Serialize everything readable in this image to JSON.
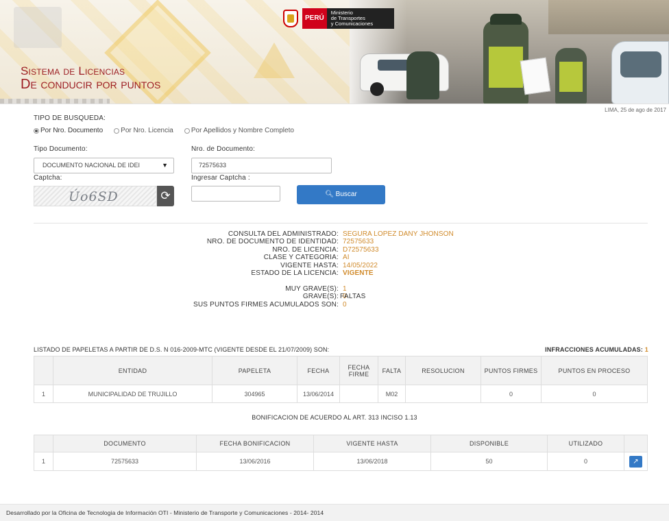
{
  "header": {
    "peru_label": "PERÚ",
    "ministry_line1": "Ministerio",
    "ministry_line2": "de Transportes",
    "ministry_line3": "y Comunicaciones",
    "title_line1": "Sistema de Licencias",
    "title_line2": "De conducir por puntos",
    "date": "LIMA, 25 de ago de 2017"
  },
  "search": {
    "tipo_busqueda_label": "TIPO DE BUSQUEDA:",
    "radio_options": [
      "Por Nro. Documento",
      "Por Nro. Licencia",
      "Por Apellidos y Nombre Completo"
    ],
    "selected_radio": 0,
    "tipo_documento_label": "Tipo Documento:",
    "tipo_documento_value": "DOCUMENTO NACIONAL DE IDEI",
    "nro_documento_label": "Nro. de Documento:",
    "nro_documento_value": "72575633",
    "captcha_label": "Captcha:",
    "captcha_text": "Úo6SD",
    "ingresar_captcha_label": "Ingresar Captcha :",
    "ingresar_captcha_value": "",
    "buscar_label": "Buscar"
  },
  "result": {
    "rows": [
      {
        "key": "CONSULTA DEL ADMINISTRADO:",
        "value": "SEGURA LOPEZ DANY JHONSON"
      },
      {
        "key": "NRO. DE DOCUMENTO DE IDENTIDAD:",
        "value": "72575633"
      },
      {
        "key": "NRO. DE LICENCIA:",
        "value": "D72575633"
      },
      {
        "key": "CLASE Y CATEGORIA:",
        "value": "AI"
      },
      {
        "key": "VIGENTE HASTA:",
        "value": "14/05/2022"
      },
      {
        "key": "ESTADO DE LA LICENCIA:",
        "value": "VIGENTE"
      }
    ],
    "faltas_label": "FALTAS",
    "faltas_rows": [
      {
        "key": "MUY GRAVE(S):",
        "value": "1"
      },
      {
        "key": "GRAVE(S):",
        "value": "0"
      },
      {
        "key": "SUS PUNTOS FIRMES ACUMULADOS SON:",
        "value": "0"
      }
    ]
  },
  "papeletas": {
    "title": "LISTADO DE PAPELETAS A PARTIR DE D.S. N 016-2009-MTC (VIGENTE DESDE EL 21/07/2009) SON:",
    "infracciones_label": "INFRACCIONES ACUMULADAS:",
    "infracciones_value": "1",
    "headers": [
      "",
      "ENTIDAD",
      "PAPELETA",
      "FECHA",
      "FECHA FIRME",
      "FALTA",
      "RESOLUCION",
      "PUNTOS FIRMES",
      "PUNTOS EN PROCESO"
    ],
    "rows": [
      [
        "1",
        "MUNICIPALIDAD DE TRUJILLO",
        "304965",
        "13/06/2014",
        "",
        "M02",
        "",
        "0",
        "0"
      ]
    ]
  },
  "bonificacion": {
    "title": "BONIFICACION DE ACUERDO AL ART. 313 INCISO 1.13",
    "headers": [
      "",
      "DOCUMENTO",
      "FECHA BONIFICACION",
      "VIGENTE HASTA",
      "DISPONIBLE",
      "UTILIZADO",
      ""
    ],
    "rows": [
      [
        "1",
        "72575633",
        "13/06/2016",
        "13/06/2018",
        "50",
        "0"
      ]
    ],
    "open_icon": "external-link-icon"
  },
  "footer": {
    "text": "Desarrollado por la Oficina de Tecnologia de Información OTI - Ministerio de Transporte y Comunicaciones - 2014- 2014"
  },
  "colors": {
    "brand_red": "#9c1d22",
    "value_orange": "#d08a2a",
    "button_blue": "#3379c6"
  }
}
